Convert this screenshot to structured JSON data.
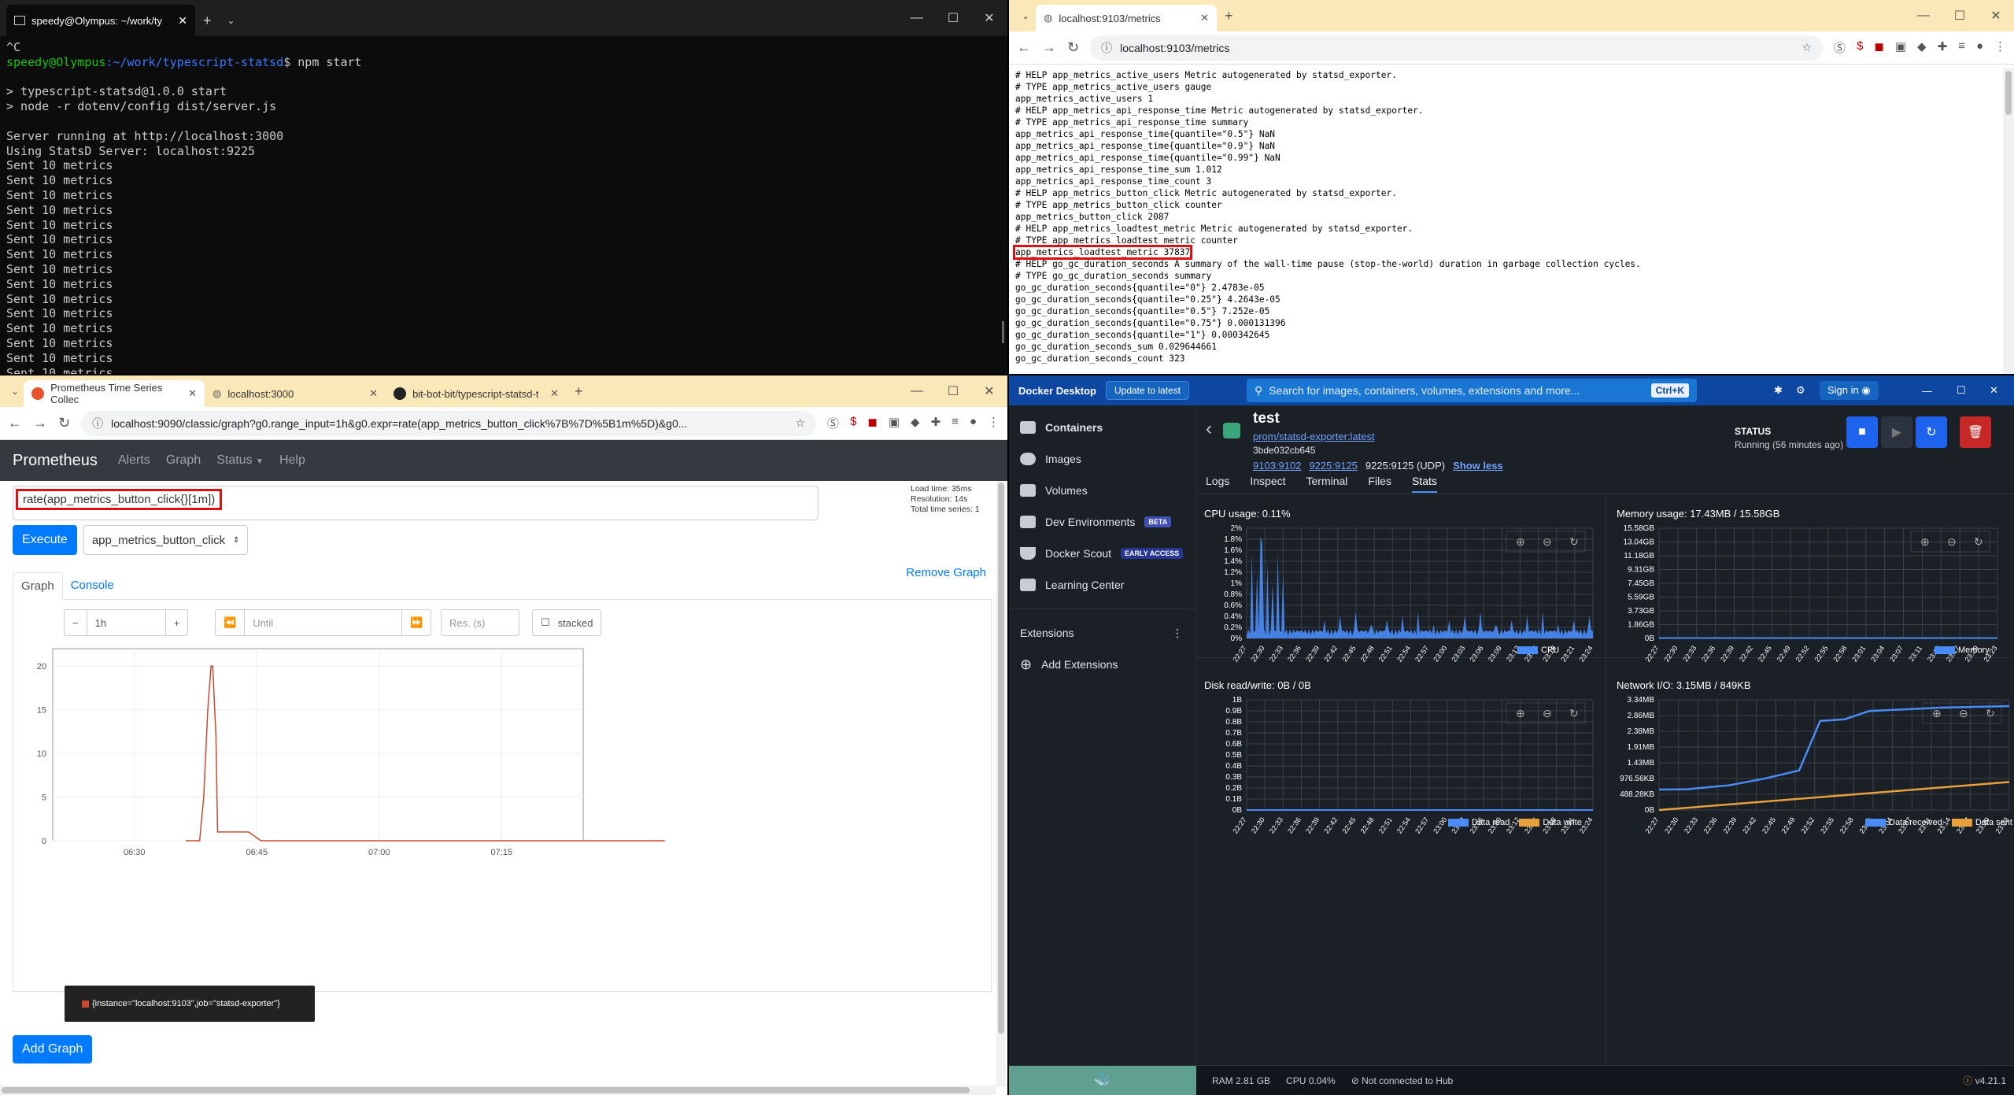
{
  "terminal": {
    "tab_title": "speedy@Olympus: ~/work/ty",
    "prompt_user": "speedy@Olympus",
    "prompt_path": ":~/work/typescript-statsd",
    "command": "$ npm start",
    "line_interrupt": "^C",
    "output_lines": [
      "",
      "> typescript-statsd@1.0.0 start",
      "> node -r dotenv/config dist/server.js",
      "",
      "Server running at http://localhost:3000",
      "Using StatsD Server: localhost:9225",
      "Sent 10 metrics",
      "Sent 10 metrics",
      "Sent 10 metrics",
      "Sent 10 metrics",
      "Sent 10 metrics",
      "Sent 10 metrics",
      "Sent 10 metrics",
      "Sent 10 metrics",
      "Sent 10 metrics",
      "Sent 10 metrics",
      "Sent 10 metrics",
      "Sent 10 metrics",
      "Sent 10 metrics",
      "Sent 10 metrics",
      "Sent 10 metrics"
    ]
  },
  "metrics_browser": {
    "tab_title": "localhost:9103/metrics",
    "url": "localhost:9103/metrics",
    "lines_before": [
      "# HELP app_metrics_active_users Metric autogenerated by statsd_exporter.",
      "# TYPE app_metrics_active_users gauge",
      "app_metrics_active_users 1",
      "# HELP app_metrics_api_response_time Metric autogenerated by statsd_exporter.",
      "# TYPE app_metrics_api_response_time summary",
      "app_metrics_api_response_time{quantile=\"0.5\"} NaN",
      "app_metrics_api_response_time{quantile=\"0.9\"} NaN",
      "app_metrics_api_response_time{quantile=\"0.99\"} NaN",
      "app_metrics_api_response_time_sum 1.012",
      "app_metrics_api_response_time_count 3",
      "# HELP app_metrics_button_click Metric autogenerated by statsd_exporter.",
      "# TYPE app_metrics_button_click counter",
      "app_metrics_button_click 2087",
      "# HELP app_metrics_loadtest_metric Metric autogenerated by statsd_exporter.",
      "# TYPE app_metrics_loadtest_metric counter"
    ],
    "highlighted_line": "app_metrics_loadtest_metric 37837",
    "lines_after": [
      "# HELP go_gc_duration_seconds A summary of the wall-time pause (stop-the-world) duration in garbage collection cycles.",
      "# TYPE go_gc_duration_seconds summary",
      "go_gc_duration_seconds{quantile=\"0\"} 2.4783e-05",
      "go_gc_duration_seconds{quantile=\"0.25\"} 4.2643e-05",
      "go_gc_duration_seconds{quantile=\"0.5\"} 7.252e-05",
      "go_gc_duration_seconds{quantile=\"0.75\"} 0.000131396",
      "go_gc_duration_seconds{quantile=\"1\"} 0.000342645",
      "go_gc_duration_seconds_sum 0.029644661",
      "go_gc_duration_seconds_count 323"
    ]
  },
  "prometheus_browser": {
    "tabs": [
      "Prometheus Time Series Collec",
      "localhost:3000",
      "bit-bot-bit/typescript-statsd-ts"
    ],
    "url": "localhost:9090/classic/graph?g0.range_input=1h&g0.expr=rate(app_metrics_button_click%7B%7D%5B1m%5D)&g0...",
    "nav": {
      "brand": "Prometheus",
      "items": [
        "Alerts",
        "Graph",
        "Status",
        "Help"
      ]
    },
    "expression": "rate(app_metrics_button_click{}[1m])",
    "stats": [
      "Load time: 35ms",
      "Resolution: 14s",
      "Total time series: 1"
    ],
    "execute_label": "Execute",
    "metric_select": "app_metrics_button_click",
    "remove_graph": "Remove Graph",
    "tab_graph": "Graph",
    "tab_console": "Console",
    "range": "1h",
    "until_placeholder": "Until",
    "res_placeholder": "Res. (s)",
    "stacked_label": "stacked",
    "legend": "{instance=\"localhost:9103\",job=\"statsd-exporter\"}",
    "add_graph": "Add Graph",
    "line_color": "#c8492f"
  },
  "chart_data": [
    {
      "type": "line",
      "x": [
        "06:30",
        "06:45",
        "07:00",
        "07:15"
      ],
      "xlim": [
        "06:20",
        "07:25"
      ],
      "ylim": [
        0,
        22
      ],
      "yticks": [
        0,
        5,
        10,
        15,
        20
      ],
      "series": [
        {
          "values_minutes": [
            [
              6.3,
              0
            ],
            [
              8.0,
              0
            ],
            [
              8.5,
              5
            ],
            [
              9.0,
              15
            ],
            [
              9.4,
              20
            ],
            [
              9.6,
              20
            ],
            [
              10.0,
              12
            ],
            [
              10.2,
              1
            ],
            [
              10.5,
              1
            ],
            [
              14.0,
              1
            ],
            [
              15.5,
              0
            ],
            [
              65,
              0
            ]
          ]
        }
      ]
    }
  ],
  "docker": {
    "app_title": "Docker Desktop",
    "update_label": "Update to latest",
    "search_placeholder": "Search for images, containers, volumes, extensions and more...",
    "shortcut": "Ctrl+K",
    "sign_in": "Sign in",
    "sidebar": [
      "Containers",
      "Images",
      "Volumes",
      "Dev Environments",
      "Docker Scout",
      "Learning Center"
    ],
    "badge_beta": "BETA",
    "badge_early": "EARLY ACCESS",
    "extensions_label": "Extensions",
    "add_extensions": "Add Extensions",
    "container_name": "test",
    "image_link": "prom/statsd-exporter:latest",
    "container_id": "3bde032cb645",
    "port1": "9103:9102",
    "port2": "9225:9125",
    "port3": "9225:9125 (UDP)",
    "show_less": "Show less",
    "status_label": "STATUS",
    "status_value": "Running (56 minutes ago)",
    "tabs": [
      "Logs",
      "Inspect",
      "Terminal",
      "Files",
      "Stats"
    ],
    "cpu_title": "CPU usage:  0.11%",
    "mem_title": "Memory usage:  17.43MB / 15.58GB",
    "disk_title": "Disk read/write:  0B / 0B",
    "net_title": "Network I/O:  3.15MB / 849KB",
    "cpu_y": [
      "2%",
      "1.8%",
      "1.6%",
      "1.4%",
      "1.2%",
      "1%",
      "0.8%",
      "0.6%",
      "0.4%",
      "0.2%",
      "0%"
    ],
    "mem_y": [
      "15.58GB",
      "13.04GB",
      "11.18GB",
      "9.31GB",
      "7.45GB",
      "5.59GB",
      "3.73GB",
      "1.86GB",
      "0B"
    ],
    "disk_y": [
      "1B",
      "0.9B",
      "0.8B",
      "0.7B",
      "0.6B",
      "0.5B",
      "0.4B",
      "0.3B",
      "0.2B",
      "0.1B",
      "0B"
    ],
    "net_y": [
      "3.34MB",
      "2.86MB",
      "2.38MB",
      "1.91MB",
      "1.43MB",
      "976.56KB",
      "488.28KB",
      "0B"
    ],
    "x_ticks": [
      "22:27",
      "22:30",
      "22:33",
      "22:36",
      "22:39",
      "22:42",
      "22:45",
      "22:48",
      "22:51",
      "22:54",
      "22:57",
      "23:00",
      "23:03",
      "23:06",
      "23:09",
      "23:12",
      "23:15",
      "23:18",
      "23:21",
      "23:24"
    ],
    "x_ticks_mem": [
      "22:27",
      "22:30",
      "22:33",
      "22:36",
      "22:39",
      "22:42",
      "22:45",
      "22:49",
      "22:52",
      "22:55",
      "22:58",
      "23:01",
      "23:04",
      "23:07",
      "23:11",
      "23:14",
      "23:17",
      "23:20",
      "23:23"
    ],
    "legend_cpu": "CPU",
    "legend_mem": "Memory",
    "legend_read": "Data read",
    "legend_write": "Data write",
    "legend_recv": "Data received",
    "legend_sent": "Data sent",
    "status_bar": {
      "ram": "RAM 2.81 GB",
      "cpu": "CPU 0.04%",
      "hub": "Not connected to Hub",
      "version": "v4.21.1"
    },
    "colors": {
      "blue": "#4a8cf7",
      "orange": "#e8a13a"
    }
  }
}
